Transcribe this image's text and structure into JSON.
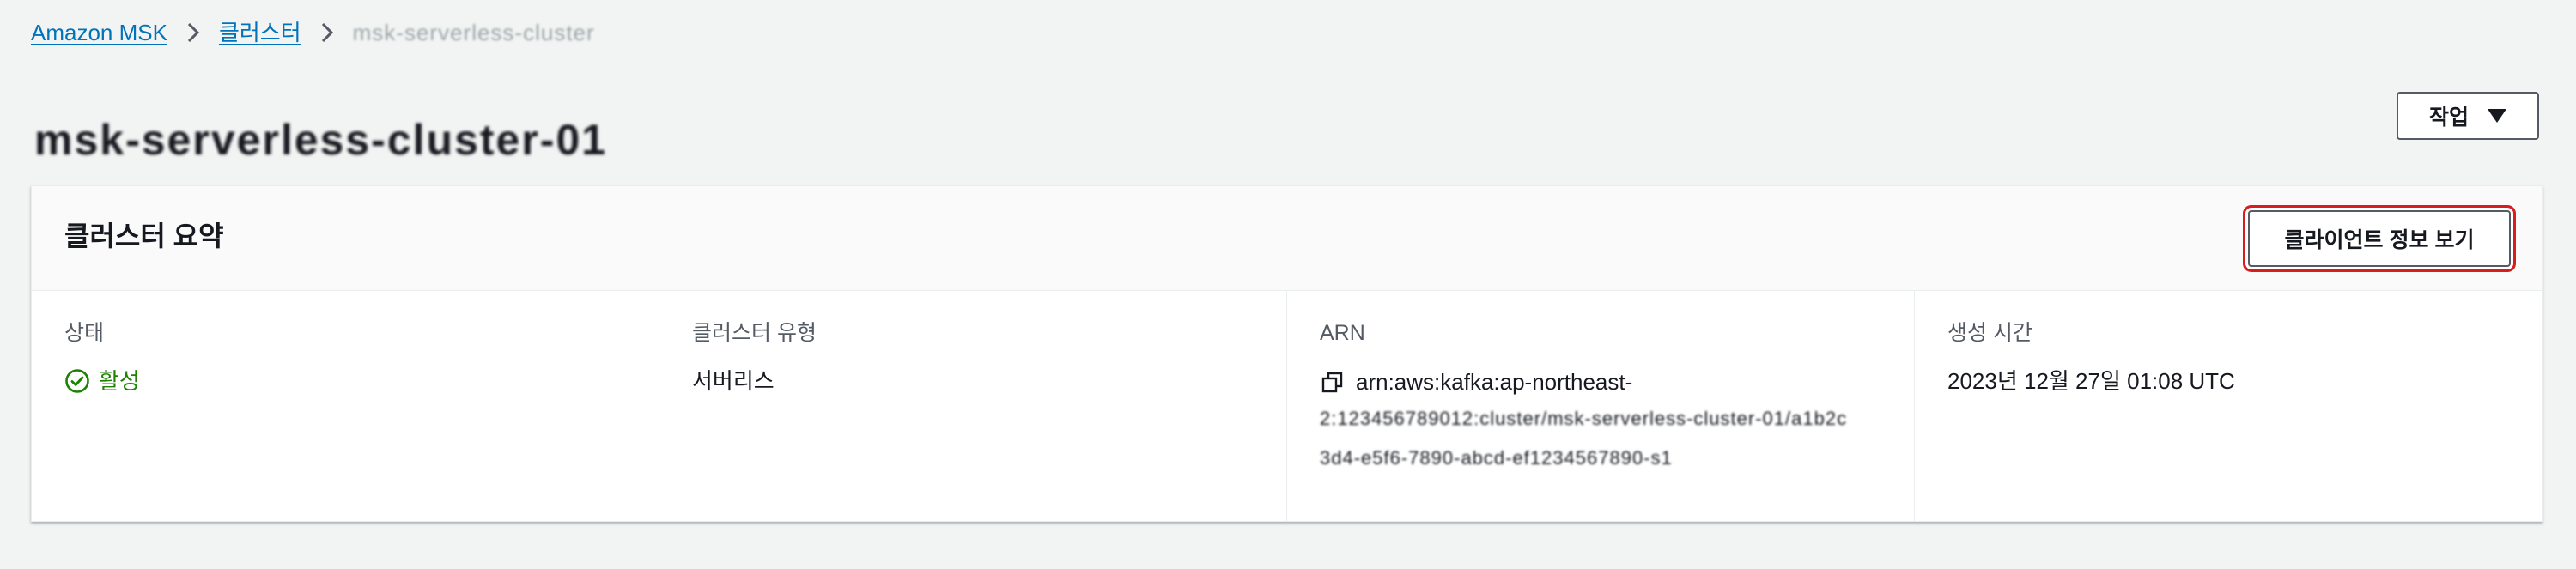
{
  "breadcrumb": {
    "root": "Amazon MSK",
    "clusters": "클러스터",
    "current": "msk-serverless-cluster"
  },
  "page": {
    "title": "msk-serverless-cluster-01"
  },
  "actions": {
    "label": "작업"
  },
  "summary": {
    "title": "클러스터 요약",
    "client_info_label": "클라이언트 정보 보기",
    "status_label": "상태",
    "status_value": "활성",
    "type_label": "클러스터 유형",
    "type_value": "서버리스",
    "arn_label": "ARN",
    "arn_prefix": "arn:aws:kafka:ap-northeast-",
    "arn_rest": "2:123456789012:cluster/msk-serverless-cluster-01/a1b2c3d4-e5f6-7890-abcd-ef1234567890-s1",
    "created_label": "생성 시간",
    "created_value": "2023년 12월 27일 01:08 UTC"
  },
  "colors": {
    "link": "#0073bb",
    "success": "#1d8102",
    "highlight": "#d91c1c"
  }
}
